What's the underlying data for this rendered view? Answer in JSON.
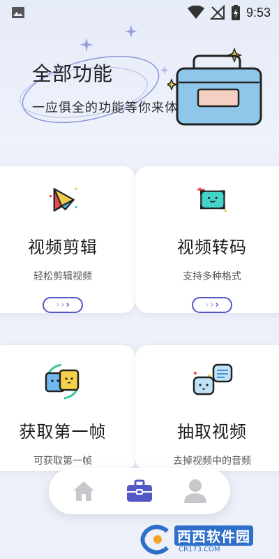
{
  "status_bar": {
    "time": "9:53",
    "icons": [
      "gallery-icon",
      "wifi-icon",
      "no-signal-icon",
      "battery-charging-icon"
    ]
  },
  "hero": {
    "title": "全部功能",
    "subtitle": "一应俱全的功能等你来体验"
  },
  "cards": [
    {
      "title": "视频剪辑",
      "subtitle": "轻松剪辑视频",
      "icon": "video-edit-icon"
    },
    {
      "title": "视频转码",
      "subtitle": "支持多种格式",
      "icon": "video-transcode-icon"
    },
    {
      "title": "获取第一帧",
      "subtitle": "可获取第一帧",
      "icon": "first-frame-icon"
    },
    {
      "title": "抽取视频",
      "subtitle": "去掉视频中的音频",
      "icon": "extract-video-icon"
    }
  ],
  "pill_arrows": "›››",
  "bottom_nav": {
    "items": [
      {
        "name": "home",
        "icon": "home-icon",
        "active": false
      },
      {
        "name": "tools",
        "icon": "toolbox-icon",
        "active": true
      },
      {
        "name": "profile",
        "icon": "user-icon",
        "active": false
      }
    ]
  },
  "watermark": {
    "brand": "西西软件园",
    "url": "CR173.COM"
  },
  "colors": {
    "accent": "#5458c7",
    "nav_active": "#5458c7",
    "nav_inactive": "#c8c8cc"
  }
}
